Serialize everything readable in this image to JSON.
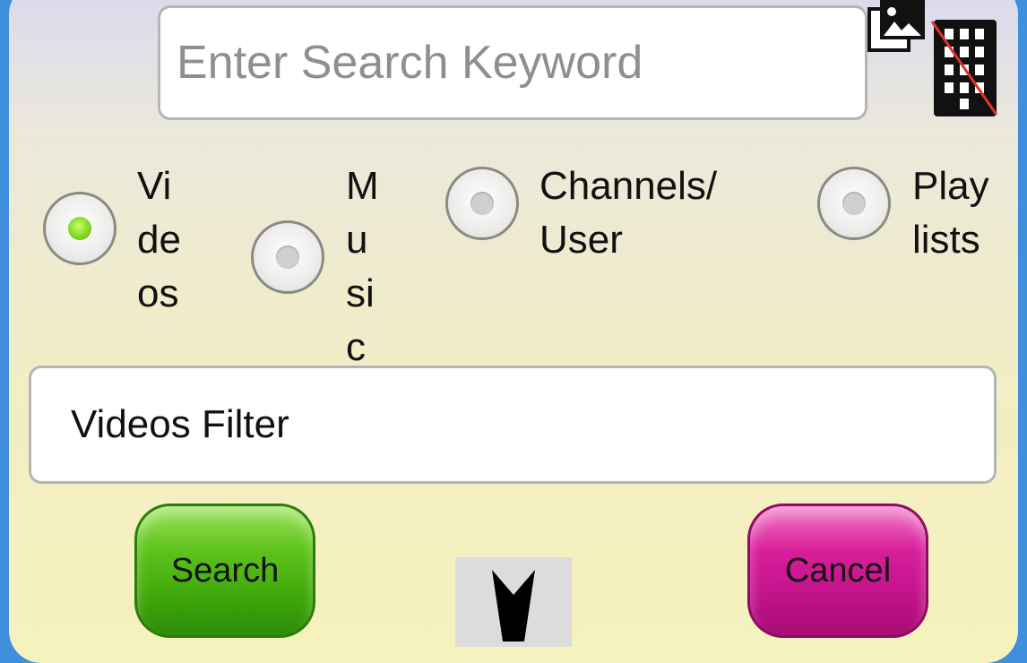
{
  "search": {
    "placeholder": "Enter Search Keyword"
  },
  "icons": {
    "gallery": "image-gallery-icon",
    "keypad": "keypad-icon"
  },
  "options": [
    {
      "id": "videos",
      "label": "Vi\nde\nos",
      "checked": true
    },
    {
      "id": "music",
      "label": "M\nu\nsi\nc",
      "checked": false
    },
    {
      "id": "channels",
      "label": "Channels/\nUser",
      "checked": false
    },
    {
      "id": "playlists",
      "label": "Play\nlists",
      "checked": false
    }
  ],
  "filter": {
    "value": "Videos Filter"
  },
  "buttons": {
    "search": "Search",
    "cancel": "Cancel"
  },
  "colors": {
    "search": "#4fb512",
    "cancel": "#d0168f",
    "selected": "#7ed321",
    "accent": "#3f8fdc"
  }
}
